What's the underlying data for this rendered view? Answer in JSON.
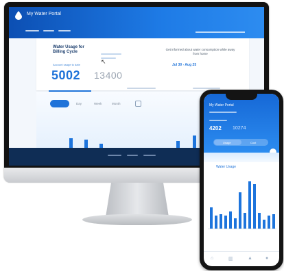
{
  "monitor": {
    "app_title": "My Water Portal",
    "logo_icon": "droplet-icon",
    "card": {
      "title": "Water Usage for Billing Cycle",
      "sub_label": "Account usage to date",
      "usage_value": "5002",
      "compare_value": "13400",
      "info_text": "Get informed about water consumption while away from home",
      "dates": "Jul 30 - Aug 25"
    },
    "chart": {
      "options": [
        "Day",
        "Week",
        "Month"
      ]
    }
  },
  "phone": {
    "header_title": "My Water Portal",
    "value_primary": "4202",
    "value_secondary": "10274",
    "segment_labels": [
      "Usage",
      "Cost"
    ],
    "chart_label": "Water Usage",
    "nav_icons": [
      "home-icon",
      "chart-icon",
      "bell-icon",
      "user-icon"
    ]
  },
  "colors": {
    "brand_blue": "#1f73d9",
    "header_dark": "#0c4fb3",
    "footer_navy": "#0f2d55"
  }
}
